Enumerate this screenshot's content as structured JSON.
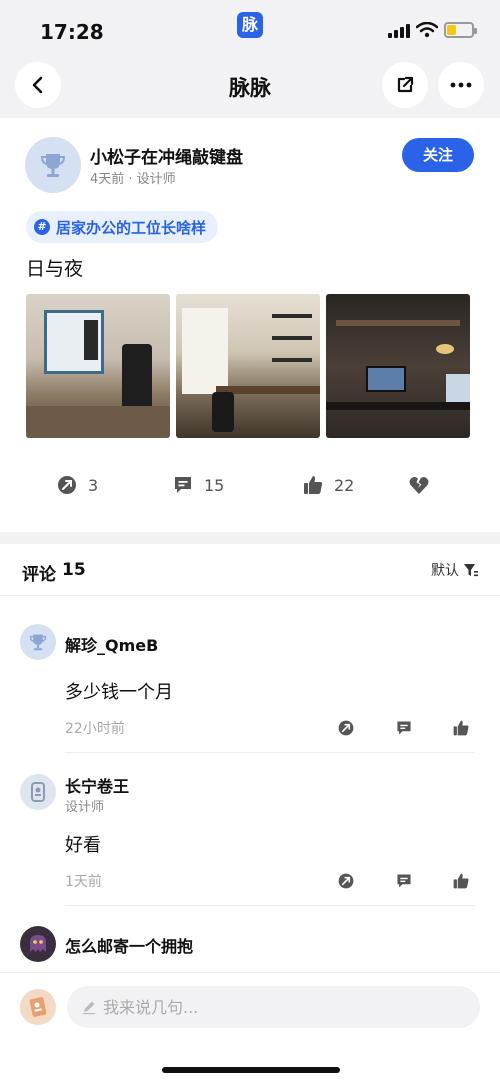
{
  "status_bar": {
    "time": "17:28",
    "app_badge": "脉",
    "battery_level": 0.35
  },
  "nav": {
    "title": "脉脉"
  },
  "post": {
    "author_name": "小松子在冲绳敲键盘",
    "author_meta": "4天前 · 设计师",
    "follow_label": "关注",
    "topic": "居家办公的工位长啥样",
    "text": "日与夜",
    "photos": [
      "photo-daytime-room",
      "photo-study-desk",
      "photo-night-desk"
    ],
    "stats": {
      "forward": "3",
      "comment": "15",
      "like": "22"
    }
  },
  "comments_header": {
    "title": "评论",
    "count": "15",
    "sort_label": "默认"
  },
  "comments": [
    {
      "name": "解珍_QmeB",
      "subtitle": "",
      "text": "多少钱一个月",
      "time": "22小时前"
    },
    {
      "name": "长宁卷王",
      "subtitle": "设计师",
      "text": "好看",
      "time": "1天前"
    },
    {
      "name": "怎么邮寄一个拥抱",
      "subtitle": "",
      "text": "",
      "time": ""
    }
  ],
  "composer": {
    "placeholder": "我来说几句..."
  },
  "colors": {
    "brand": "#2a63e8",
    "background_gray": "#f2f2f4"
  }
}
